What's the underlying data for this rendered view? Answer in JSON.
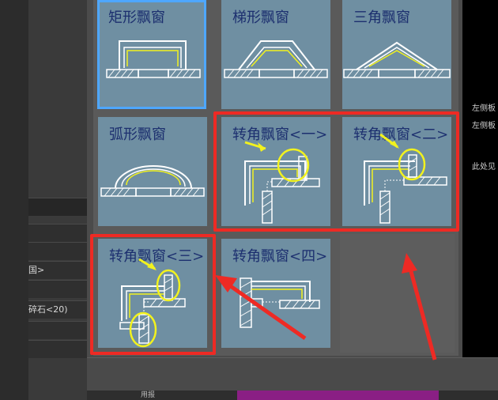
{
  "tiles": [
    {
      "label": "矩形飘窗",
      "selected": true
    },
    {
      "label": "梯形飘窗"
    },
    {
      "label": "三角飘窗"
    },
    {
      "label": "弧形飘窗"
    },
    {
      "label": "转角飘窗<一>"
    },
    {
      "label": "转角飘窗<二>"
    },
    {
      "label": "转角飘窗<三>"
    },
    {
      "label": "转角飘窗<四>"
    }
  ],
  "left_panel": {
    "row1": "国>",
    "row2": "碎石<20)"
  },
  "right_panel": {
    "line1": "左侧板",
    "line2": "左侧板",
    "line3": "此处见"
  },
  "bottom_label": "用报",
  "colors": {
    "tile_bg": "#6f8fa2",
    "selected_border": "#4ea7ff",
    "annotation_red": "#ee2a24",
    "highlight_yellow": "#f2f21e"
  }
}
